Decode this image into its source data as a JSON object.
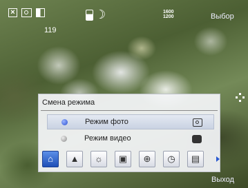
{
  "status": {
    "shot_count": "119",
    "resolution_top": "1600",
    "resolution_bottom": "1200"
  },
  "softkeys": {
    "select": "Выбор",
    "exit": "Выход"
  },
  "menu": {
    "title": "Смена режима",
    "options": [
      {
        "label": "Режим фото",
        "selected": true,
        "icon": "photo-camera-icon"
      },
      {
        "label": "Режим видео",
        "selected": false,
        "icon": "video-camera-icon"
      }
    ]
  },
  "toolbar": {
    "items": [
      {
        "icon": "camera-mode-icon",
        "glyph": "⌂",
        "active": true
      },
      {
        "icon": "scene-landscape-icon",
        "glyph": "▲"
      },
      {
        "icon": "white-balance-icon",
        "glyph": "☼"
      },
      {
        "icon": "effects-icon",
        "glyph": "▣"
      },
      {
        "icon": "zoom-icon",
        "glyph": "⊕"
      },
      {
        "icon": "timer-icon",
        "glyph": "◷"
      },
      {
        "icon": "settings-icon",
        "glyph": "▤"
      }
    ],
    "more_icon": "chevron-right-icon"
  },
  "colors": {
    "menu_bg": "#f5f6fa",
    "selected_row": "#c9d2e2",
    "active_button": "#1e4fb6",
    "accent_dot": "#2a4fd0"
  }
}
